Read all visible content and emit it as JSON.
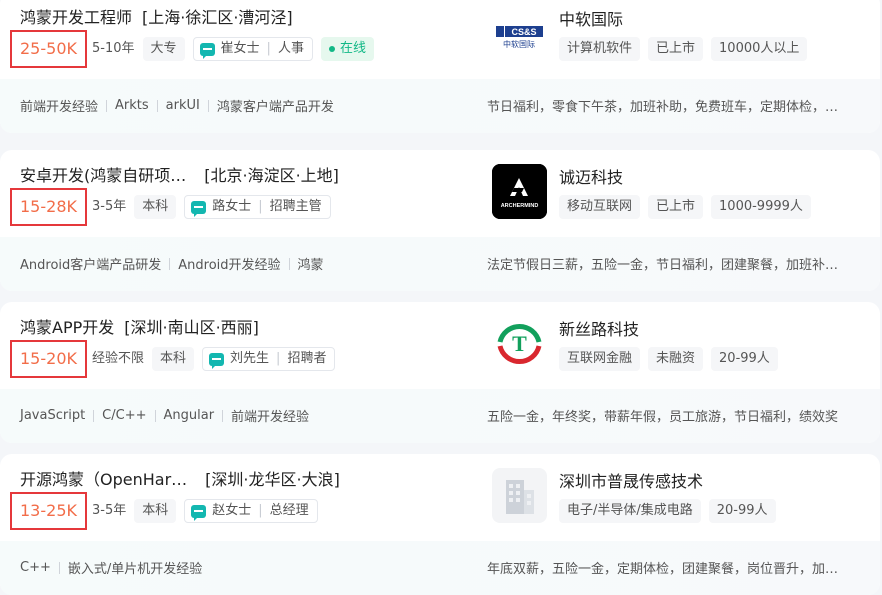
{
  "jobs": [
    {
      "title": "鸿蒙开发工程师",
      "location": "[上海·徐汇区·漕河泾]",
      "salary": "25-50K",
      "experience": "5-10年",
      "education": "大专",
      "recruiter_name": "崔女士",
      "recruiter_role": "人事",
      "online": "在线",
      "skills": [
        "前端开发经验",
        "Arkts",
        "arkUI",
        "鸿蒙客户端产品开发"
      ],
      "company": "中软国际",
      "company_tags": [
        "计算机软件",
        "已上市",
        "10000人以上"
      ],
      "welfare": "节日福利，零食下午茶，加班补助，免费班车，定期体检，…",
      "logo_text": [
        "CS&S",
        "中软国际"
      ]
    },
    {
      "title": "安卓开发(鸿蒙自研项…",
      "location": "[北京·海淀区·上地]",
      "salary": "15-28K",
      "experience": "3-5年",
      "education": "本科",
      "recruiter_name": "路女士",
      "recruiter_role": "招聘主管",
      "skills": [
        "Android客户端产品研发",
        "Android开发经验",
        "鸿蒙"
      ],
      "company": "诚迈科技",
      "company_tags": [
        "移动互联网",
        "已上市",
        "1000-9999人"
      ],
      "welfare": "法定节假日三薪，五险一金，节日福利，团建聚餐，加班补…",
      "logo_text": [
        "ARCHERMIND"
      ]
    },
    {
      "title": "鸿蒙APP开发",
      "location": "[深圳·南山区·西丽]",
      "salary": "15-20K",
      "experience": "经验不限",
      "education": "本科",
      "recruiter_name": "刘先生",
      "recruiter_role": "招聘者",
      "skills": [
        "JavaScript",
        "C/C++",
        "Angular",
        "前端开发经验"
      ],
      "company": "新丝路科技",
      "company_tags": [
        "互联网金融",
        "未融资",
        "20-99人"
      ],
      "welfare": "五险一金，年终奖，带薪年假，员工旅游，节日福利，绩效奖",
      "logo_text": [
        "T"
      ]
    },
    {
      "title": "开源鸿蒙（OpenHar…",
      "location": "[深圳·龙华区·大浪]",
      "salary": "13-25K",
      "experience": "3-5年",
      "education": "本科",
      "recruiter_name": "赵女士",
      "recruiter_role": "总经理",
      "skills": [
        "C++",
        "嵌入式/单片机开发经验"
      ],
      "company": "深圳市普晟传感技术",
      "company_tags": [
        "电子/半导体/集成电路",
        "20-99人"
      ],
      "welfare": "年底双薪，五险一金，定期体检，团建聚餐，岗位晋升，加…",
      "logo_text": []
    }
  ],
  "colors": {
    "salary": "#f26d49",
    "highlight_border": "#e5383b",
    "online": "#12b886",
    "chat_icon": "#13b7b0"
  }
}
